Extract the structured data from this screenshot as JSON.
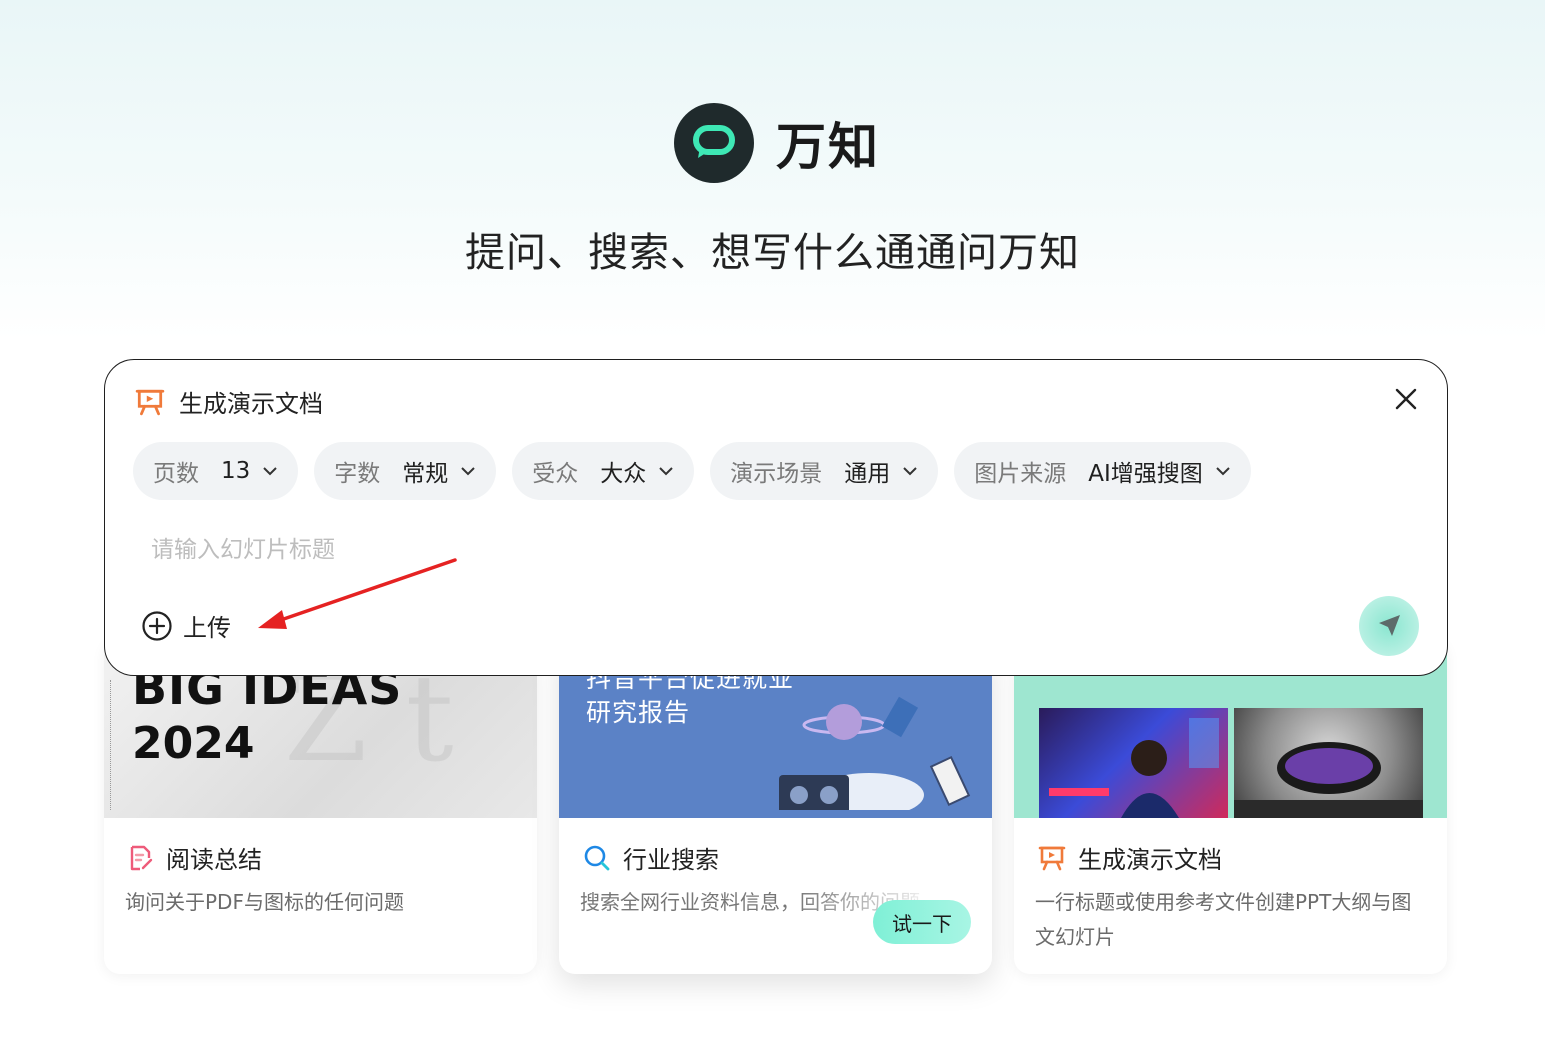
{
  "brand": {
    "name": "万知"
  },
  "tagline": "提问、搜索、想写什么通通问万知",
  "panel": {
    "mode_title": "生成演示文档",
    "chips": [
      {
        "label": "页数",
        "value": "13"
      },
      {
        "label": "字数",
        "value": "常规"
      },
      {
        "label": "受众",
        "value": "大众"
      },
      {
        "label": "演示场景",
        "value": "通用"
      },
      {
        "label": "图片来源",
        "value": "AI增强搜图"
      }
    ],
    "input_placeholder": "请输入幻灯片标题",
    "upload_label": "上传"
  },
  "cards": [
    {
      "title": "阅读总结",
      "desc": "询问关于PDF与图标的任何问题",
      "image_text": [
        "BIG IDEAS",
        "2024"
      ]
    },
    {
      "title": "行业搜索",
      "desc": "搜索全网行业资料信息，回答你的问题",
      "image_text": [
        "抖音平台促进就业",
        "研究报告"
      ],
      "action": "试一下"
    },
    {
      "title": "生成演示文档",
      "desc": "一行标题或使用参考文件创建PPT大纲与图文幻灯片"
    }
  ],
  "colors": {
    "accent": "#7ff0d6",
    "logo_bg": "#1f2a2c",
    "logo_mark": "#3ee8b5",
    "ppt_icon": "#f07a3a",
    "read_icon": "#ee5b7a",
    "search_icon": "#1e88e5",
    "annotation_arrow": "#e52222"
  }
}
